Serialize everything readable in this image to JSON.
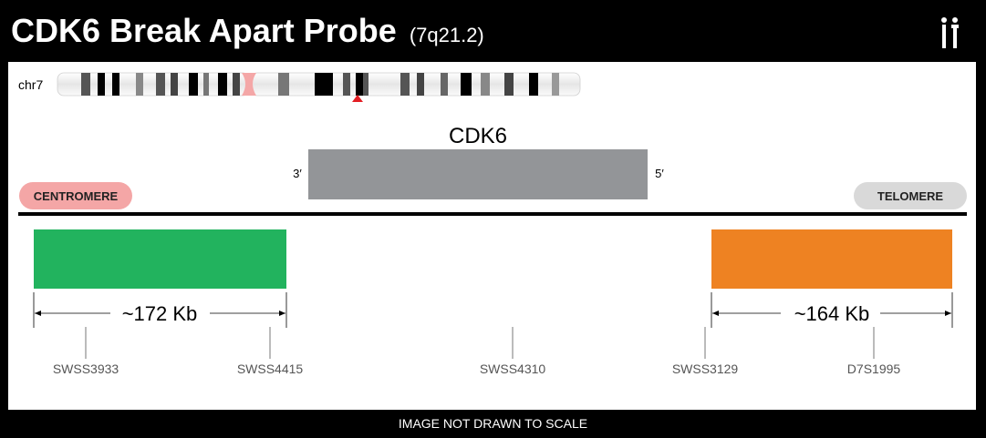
{
  "header": {
    "title": "CDK6 Break Apart Probe",
    "subtitle": "(7q21.2)"
  },
  "chromosome": {
    "label": "chr7"
  },
  "gene": {
    "name": "CDK6",
    "left_end": "3′",
    "right_end": "5′"
  },
  "ends": {
    "left": "CENTROMERE",
    "right": "TELOMERE"
  },
  "probes": [
    {
      "size": "~172 Kb",
      "color": "#22b35e"
    },
    {
      "size": "~164 Kb",
      "color": "#ee8222"
    }
  ],
  "markers": [
    "SWSS3933",
    "SWSS4415",
    "SWSS4310",
    "SWSS3129",
    "D7S1995"
  ],
  "colors": {
    "gene_bar": "#939598",
    "centromere_pill": "#f4a6a6",
    "telomere_pill": "#d9d9d9",
    "centromere_band": "#f4a7a7"
  },
  "footer": {
    "note": "IMAGE NOT DRAWN TO SCALE"
  }
}
